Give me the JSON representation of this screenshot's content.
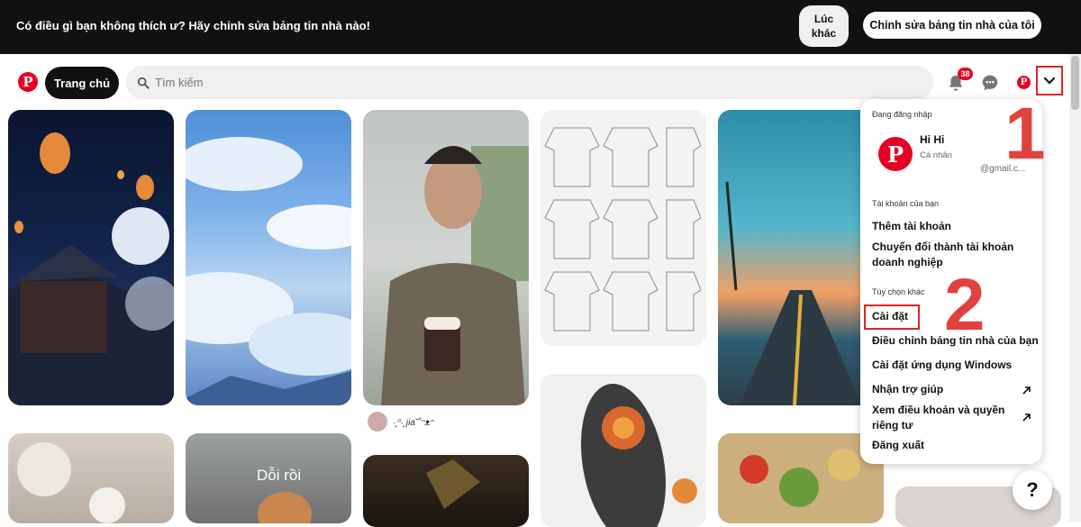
{
  "banner": {
    "text": "Có điều gì bạn không thích ư? Hãy chỉnh sửa bảng tin nhà nào!",
    "later_label": "Lúc khác",
    "edit_label": "Chỉnh sửa bảng tin nhà của tôi"
  },
  "header": {
    "logo": "P",
    "home_label": "Trang chủ",
    "search_placeholder": "Tìm kiếm",
    "notification_count": "38",
    "avatar_letter": "P"
  },
  "pins": {
    "pin3_user": "·̩͙꙳·̩͙ jia˜˚ᵔᴥᵔ",
    "pin6_overlay": "Dỗi rồi"
  },
  "menu": {
    "logged_in_label": "Đang đăng nhập",
    "account_name": "Hi Hi",
    "account_type": "Cá nhân",
    "account_email": "@gmail.c...",
    "your_accounts_label": "Tài khoản của bạn",
    "add_account": "Thêm tài khoản",
    "convert_business": "Chuyển đổi thành tài khoản doanh nghiệp",
    "other_options_label": "Tùy chọn khác",
    "settings": "Cài đặt",
    "tune_feed": "Điều chỉnh bảng tin nhà của bạn",
    "windows_app_settings": "Cài đặt ứng dụng Windows",
    "get_help": "Nhận trợ giúp",
    "terms_privacy": "Xem điều khoản và quyền riêng tư",
    "logout": "Đăng xuất"
  },
  "annotations": {
    "step1": "1",
    "step2": "2",
    "color": "#e0433e"
  },
  "help_label": "?",
  "colors": {
    "brand": "#e60023",
    "banner_bg": "#111111"
  }
}
